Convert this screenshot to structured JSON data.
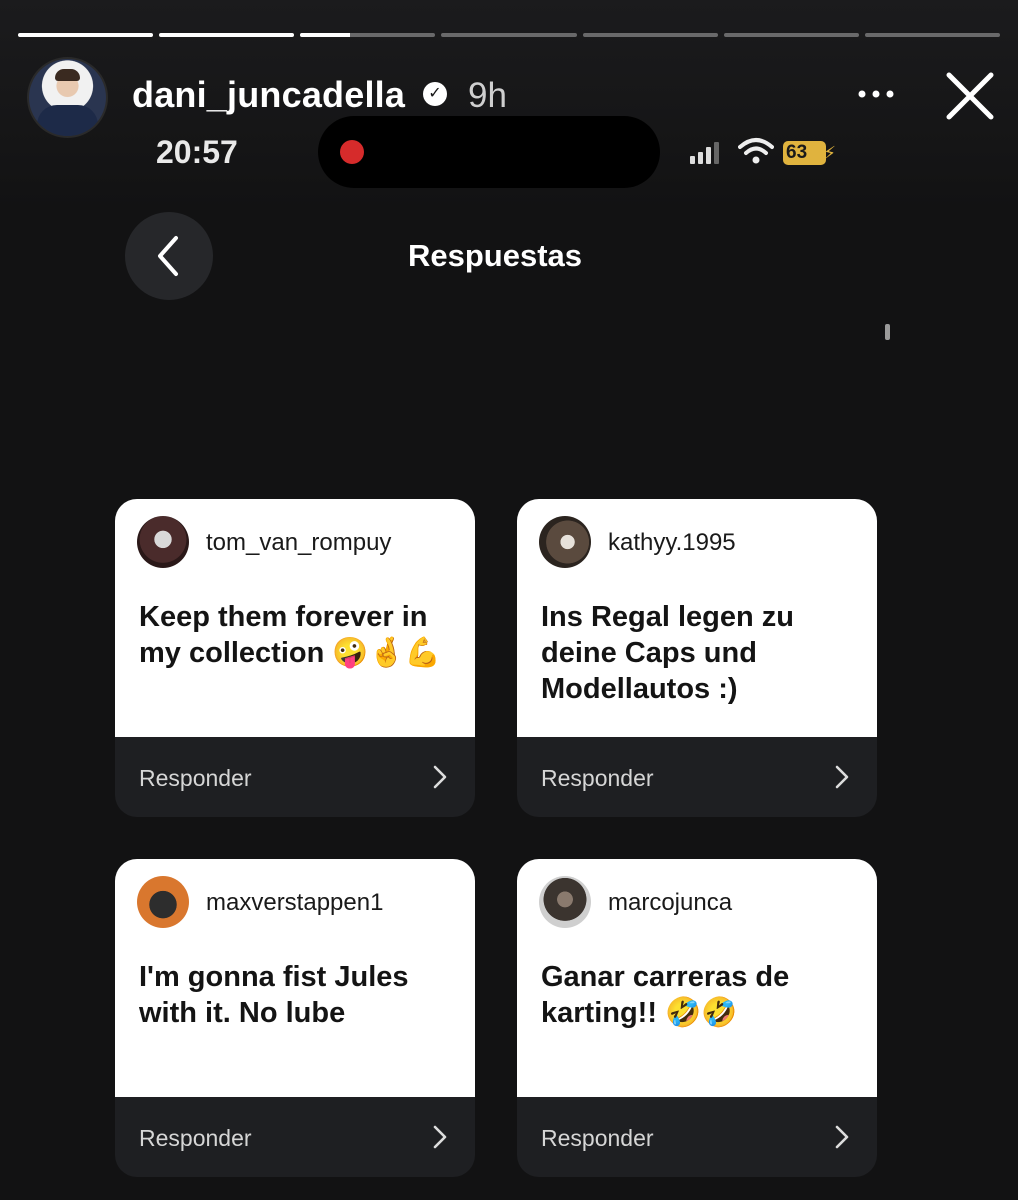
{
  "story": {
    "username": "dani_juncadella",
    "time_ago": "9h",
    "progress": [
      1,
      1,
      0.37,
      0,
      0,
      0,
      0
    ]
  },
  "phone": {
    "time": "20:57",
    "battery": "63"
  },
  "screen": {
    "title": "Respuestas"
  },
  "cards": [
    {
      "handle": "tom_van_rompuy",
      "message": "Keep them forever in my collection 🤪🤞💪",
      "reply_label": "Responder"
    },
    {
      "handle": "kathyy.1995",
      "message": "Ins Regal legen zu deine Caps und Modellautos :)",
      "reply_label": "Responder"
    },
    {
      "handle": "maxverstappen1",
      "message": "I'm gonna fist Jules with it. No lube",
      "reply_label": "Responder"
    },
    {
      "handle": "marcojunca",
      "message": "Ganar carreras de karting!! 🤣🤣",
      "reply_label": "Responder"
    }
  ],
  "icons": {
    "more": "more-horizontal-icon",
    "close": "close-icon",
    "back": "chevron-left-icon",
    "chevron": "chevron-right-icon",
    "verified": "verified-badge-icon"
  },
  "colors": {
    "background": "#121213",
    "card_body": "#ffffff",
    "card_footer": "#1e1f22",
    "battery": "#e0b33e",
    "record_dot": "#d62b2b"
  }
}
